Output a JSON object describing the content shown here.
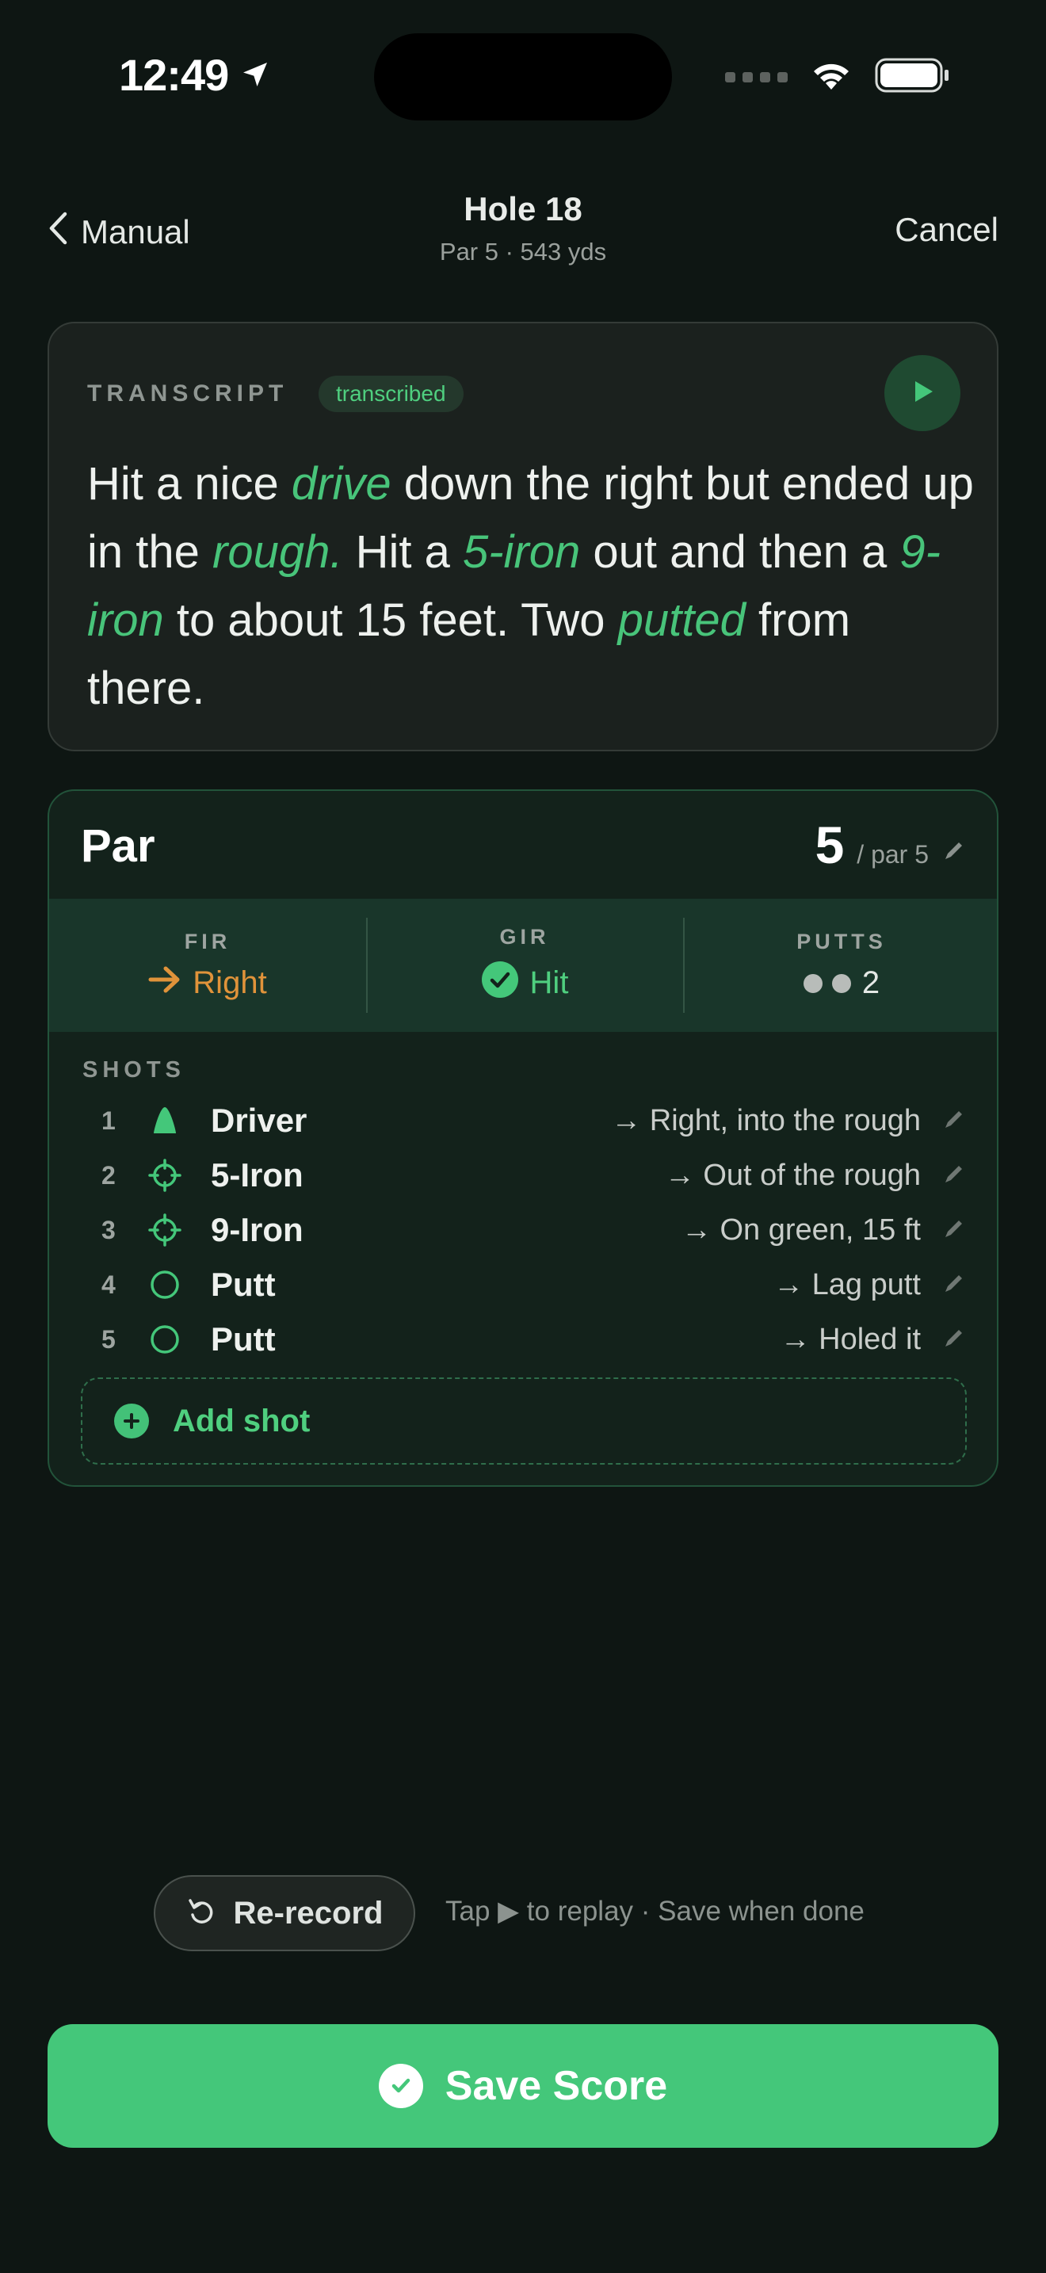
{
  "status_bar": {
    "time": "12:49",
    "icons": [
      "location-arrow-icon",
      "cellular-dots-icon",
      "wifi-icon",
      "battery-icon"
    ]
  },
  "nav": {
    "back_label": "Manual",
    "title": "Hole 18",
    "subtitle": "Par 5 · 543 yds",
    "cancel_label": "Cancel"
  },
  "transcript": {
    "label": "TRANSCRIPT",
    "badge": "transcribed",
    "segments": [
      {
        "t": "Hit a nice ",
        "kw": false
      },
      {
        "t": "drive",
        "kw": true
      },
      {
        "t": " down the right but ended up in the ",
        "kw": false
      },
      {
        "t": "rough.",
        "kw": true
      },
      {
        "t": " Hit a ",
        "kw": false
      },
      {
        "t": "5-iron",
        "kw": true
      },
      {
        "t": " out and then a ",
        "kw": false
      },
      {
        "t": "9-iron",
        "kw": true
      },
      {
        "t": " to about 15 feet. Two ",
        "kw": false
      },
      {
        "t": "putted",
        "kw": true
      },
      {
        "t": " from there.",
        "kw": false
      }
    ]
  },
  "hole": {
    "result": "Par",
    "score": "5",
    "par_label": "/ par 5",
    "stats": {
      "fir": {
        "label": "FIR",
        "value": "Right"
      },
      "gir": {
        "label": "GIR",
        "value": "Hit"
      },
      "putts": {
        "label": "PUTTS",
        "value": "2",
        "count": 2
      }
    },
    "shots_label": "SHOTS",
    "shots": [
      {
        "num": "1",
        "icon": "tee-icon",
        "club": "Driver",
        "result": "→ Right, into the rough"
      },
      {
        "num": "2",
        "icon": "crosshair-icon",
        "club": "5-Iron",
        "result": "→ Out of the rough"
      },
      {
        "num": "3",
        "icon": "crosshair-icon",
        "club": "9-Iron",
        "result": "→ On green, 15 ft"
      },
      {
        "num": "4",
        "icon": "circle-icon",
        "club": "Putt",
        "result": "→ Lag putt"
      },
      {
        "num": "5",
        "icon": "circle-icon",
        "club": "Putt",
        "result": "→ Holed it"
      }
    ],
    "add_shot_label": "Add shot"
  },
  "footer": {
    "rerecord_label": "Re-record",
    "hint": "Tap ▶ to replay · Save when done",
    "save_label": "Save Score"
  },
  "colors": {
    "accent": "#44c77a",
    "fir": "#e0933a",
    "background": "#0e1613"
  }
}
